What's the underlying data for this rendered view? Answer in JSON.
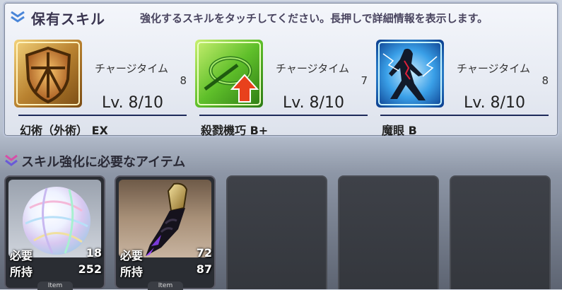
{
  "panel": {
    "title": "保有スキル",
    "instruction": "強化するスキルをタッチしてください。長押しで詳細情報を表示します。"
  },
  "skills": [
    {
      "name": "幻術（外術） EX",
      "charge_label": "チャージタイム",
      "charge_value": "8",
      "level": "Lv. 8/10",
      "icon": "shield-skill-icon"
    },
    {
      "name": "殺戮機巧 B+",
      "charge_label": "チャージタイム",
      "charge_value": "7",
      "level": "Lv. 8/10",
      "icon": "ring-arrow-up-skill-icon"
    },
    {
      "name": "魔眼 B",
      "charge_label": "チャージタイム",
      "charge_value": "8",
      "level": "Lv. 8/10",
      "icon": "lightning-figure-skill-icon"
    }
  ],
  "items_section": {
    "title": "スキル強化に必要なアイテム"
  },
  "items": [
    {
      "required_label": "必要",
      "required": "18",
      "owned_label": "所持",
      "owned": "252",
      "tag": "Item",
      "icon": "rainbow-sphere-icon"
    },
    {
      "required_label": "必要",
      "required": "72",
      "owned_label": "所持",
      "owned": "87",
      "tag": "Item",
      "icon": "dark-claw-icon"
    }
  ],
  "colors": {
    "panel_bg": "#e7ebf3",
    "accent_line": "#1d2a5a",
    "chevron_blue": "#4a86d8",
    "chevron_pink": "#d64fa8",
    "empty_slot": "#3a3d44"
  }
}
